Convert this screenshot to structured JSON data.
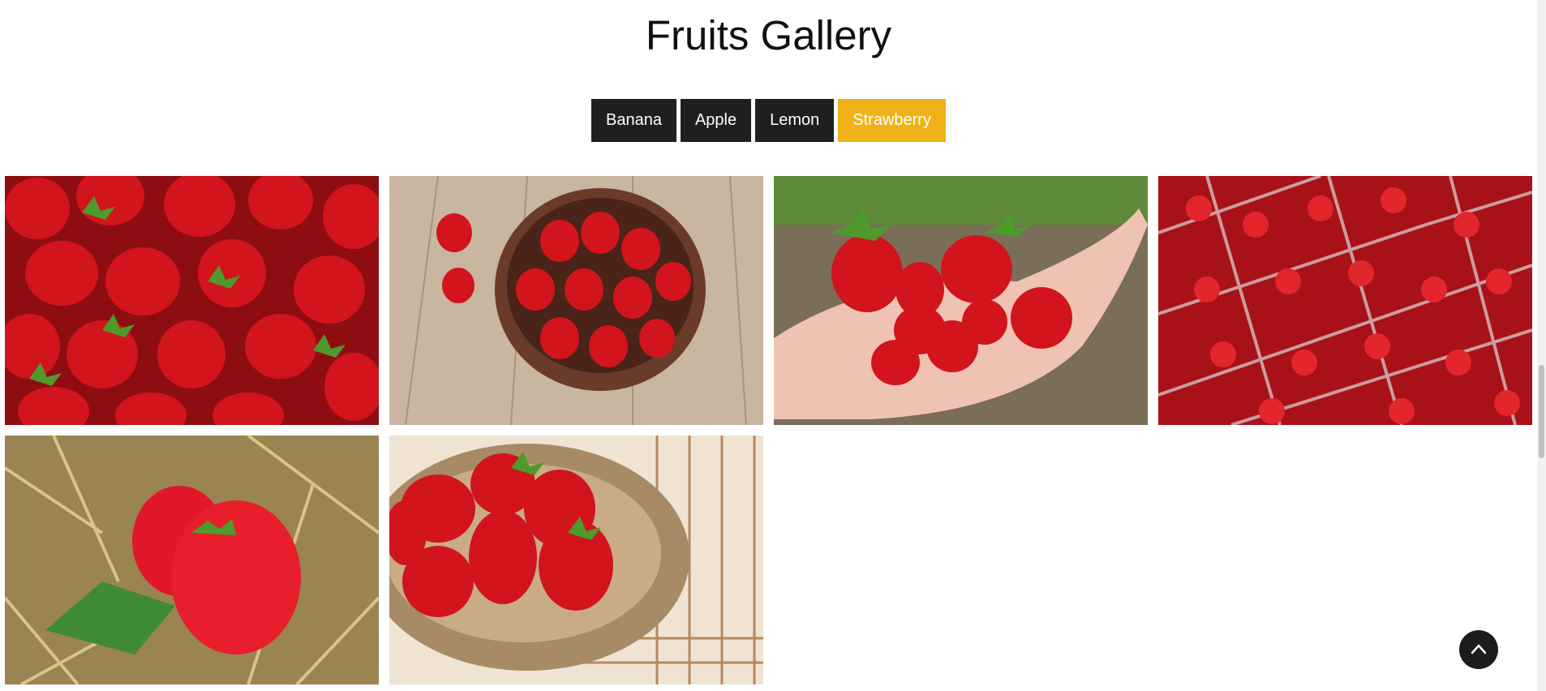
{
  "page": {
    "title": "Fruits Gallery"
  },
  "filters": [
    {
      "label": "Banana",
      "active": false
    },
    {
      "label": "Apple",
      "active": false
    },
    {
      "label": "Lemon",
      "active": false
    },
    {
      "label": "Strawberry",
      "active": true
    }
  ],
  "colors": {
    "button_dark": "#1f1f1f",
    "button_active": "#efb317",
    "strawberry_red": "#d2141c"
  },
  "gallery": {
    "images": [
      {
        "subject": "pile-of-strawberries"
      },
      {
        "subject": "strawberries-in-bowl-on-wood"
      },
      {
        "subject": "strawberries-in-hand"
      },
      {
        "subject": "strawberries-in-punnets"
      },
      {
        "subject": "strawberries-on-straw"
      },
      {
        "subject": "strawberries-in-wicker-basket"
      }
    ]
  },
  "icons": {
    "back_to_top": "chevron-up-icon"
  }
}
